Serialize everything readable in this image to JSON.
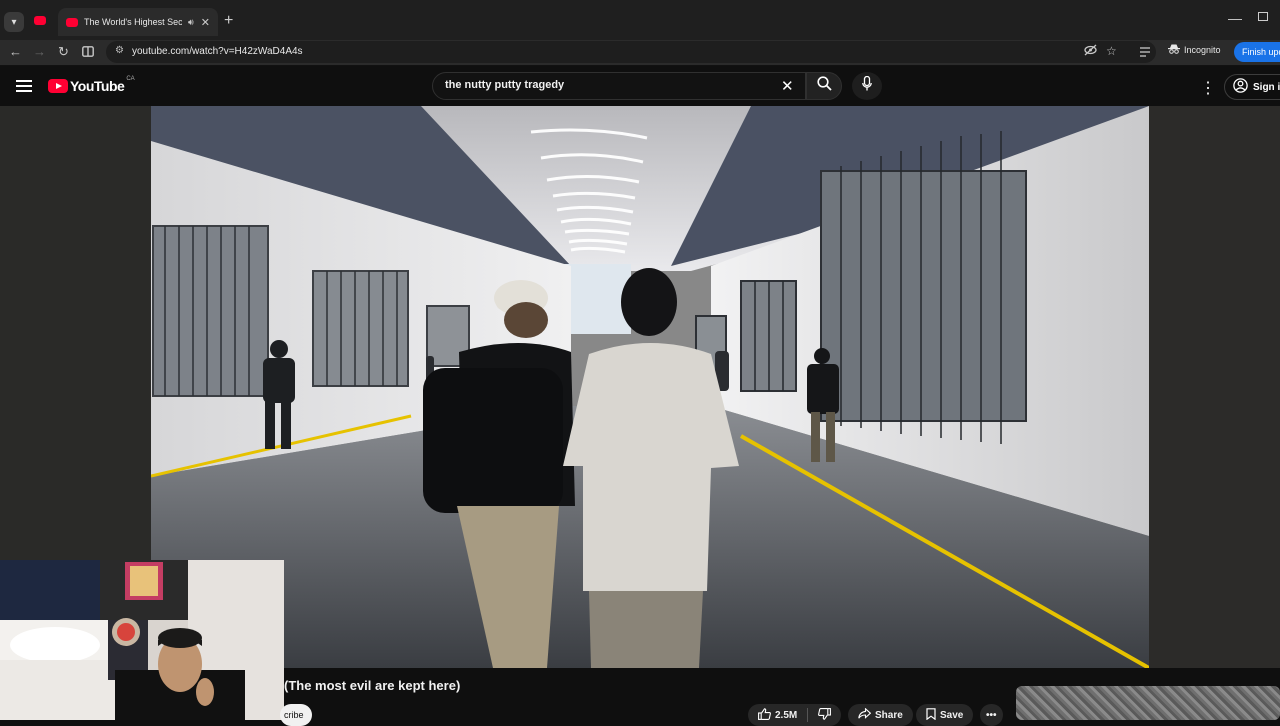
{
  "browser": {
    "tab": {
      "title": "The World's Highest Securi"
    },
    "url": "youtube.com/watch?v=H42zWaD4A4s",
    "incognito_label": "Incognito",
    "finish_update_label": "Finish upda"
  },
  "youtube": {
    "logo_text": "YouTube",
    "country_code": "CA",
    "search": {
      "value": "the nutty putty tragedy"
    },
    "sign_in_label": "Sign in"
  },
  "video": {
    "title_visible": "(The most evil are kept here)",
    "subscribe_label": "cribe",
    "likes": "2.5M",
    "share_label": "Share",
    "save_label": "Save"
  },
  "colors": {
    "youtube_red": "#ff0033",
    "chrome_blue": "#1a73e8",
    "floor_line_yellow": "#e6c200"
  }
}
